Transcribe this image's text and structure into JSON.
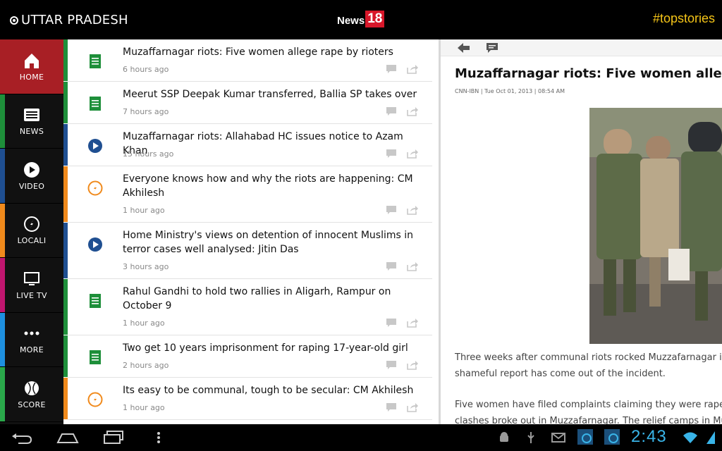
{
  "header": {
    "region": "UTTAR PRADESH",
    "logo_word": "News",
    "logo_number": "18",
    "hashtag": "#topstories"
  },
  "colors": {
    "nav_active": "#a81f25",
    "hashtag": "#f5c518",
    "clock": "#39b4e8",
    "text_green": "#1e8f3a",
    "video_blue": "#1f4f91",
    "local_orange": "#f08a1c"
  },
  "nav": [
    {
      "label": "HOME",
      "icon": "home-icon",
      "stripe": "#a81f25",
      "active": true
    },
    {
      "label": "NEWS",
      "icon": "news-icon",
      "stripe": "#1e8f3a",
      "active": false
    },
    {
      "label": "VIDEO",
      "icon": "video-icon",
      "stripe": "#1f4f91",
      "active": false
    },
    {
      "label": "LOCALI",
      "icon": "compass-icon",
      "stripe": "#f08a1c",
      "active": false
    },
    {
      "label": "LIVE TV",
      "icon": "tv-icon",
      "stripe": "#c0166f",
      "active": false
    },
    {
      "label": "MORE",
      "icon": "more-icon",
      "stripe": "#1e90e0",
      "active": false
    },
    {
      "label": "SCORE",
      "icon": "cricket-ball-icon",
      "stripe": "#2aa84a",
      "active": false
    }
  ],
  "stories": [
    {
      "title": "Muzaffarnagar riots: Five women allege rape by rioters",
      "time": "6 hours ago",
      "type": "text"
    },
    {
      "title": "Meerut SSP Deepak Kumar transferred, Ballia SP takes over",
      "time": "7 hours ago",
      "type": "text"
    },
    {
      "title": "Muzaffarnagar riots: Allahabad HC issues notice to Azam Khan",
      "time": "15 hours ago",
      "type": "video"
    },
    {
      "title": "Everyone knows how and why the riots are happening: CM Akhilesh",
      "time": "1 hour ago",
      "type": "local"
    },
    {
      "title": "Home Ministry's views on detention of innocent Muslims in terror cases well analysed: Jitin Das",
      "time": "3 hours ago",
      "type": "video"
    },
    {
      "title": "Rahul Gandhi to hold two rallies in Aligarh, Rampur on October 9",
      "time": "1 hour ago",
      "type": "text"
    },
    {
      "title": "Two get 10 years imprisonment for raping 17-year-old girl",
      "time": "2 hours ago",
      "type": "text"
    },
    {
      "title": "Its easy to be communal, tough to be secular: CM Akhilesh",
      "time": "1 hour ago",
      "type": "local"
    }
  ],
  "article": {
    "title": "Muzaffarnagar riots: Five women allege rap",
    "meta": "CNN-IBN | Tue Oct 01, 2013 | 08:54 AM",
    "para1_line1": "Three weeks after communal riots rocked Muzzafarnagar in U",
    "para1_line2": "shameful report has come out of the incident.",
    "para2_line1": "Five women have filed complaints claiming they were raped b",
    "para2_line2": "clashes broke out in Muzzafarnagar. The relief camps in Mu"
  },
  "system": {
    "clock": "2:43"
  }
}
